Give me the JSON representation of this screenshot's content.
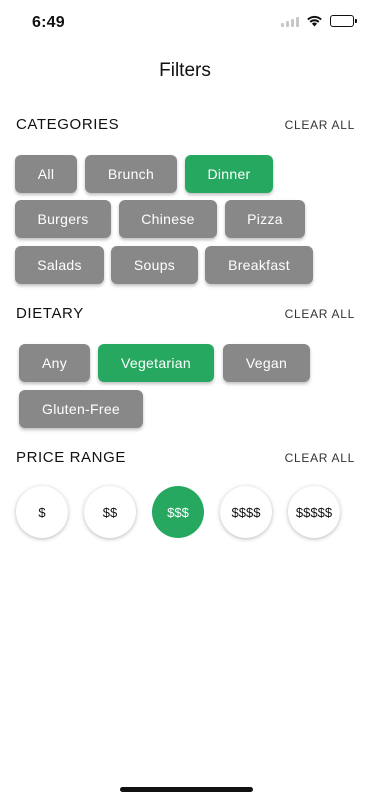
{
  "status_bar": {
    "time": "6:49"
  },
  "header": {
    "title": "Filters"
  },
  "categories": {
    "title": "CATEGORIES",
    "clear_label": "CLEAR ALL",
    "chips": [
      {
        "label": "All",
        "selected": false
      },
      {
        "label": "Brunch",
        "selected": false
      },
      {
        "label": "Dinner",
        "selected": true
      },
      {
        "label": "Burgers",
        "selected": false
      },
      {
        "label": "Chinese",
        "selected": false
      },
      {
        "label": "Pizza",
        "selected": false
      },
      {
        "label": "Salads",
        "selected": false
      },
      {
        "label": "Soups",
        "selected": false
      },
      {
        "label": "Breakfast",
        "selected": false
      }
    ]
  },
  "dietary": {
    "title": "DIETARY",
    "clear_label": "CLEAR ALL",
    "chips": [
      {
        "label": "Any",
        "selected": false
      },
      {
        "label": "Vegetarian",
        "selected": true
      },
      {
        "label": "Vegan",
        "selected": false
      },
      {
        "label": "Gluten-Free",
        "selected": false
      }
    ]
  },
  "price_range": {
    "title": "PRICE RANGE",
    "clear_label": "CLEAR ALL",
    "options": [
      {
        "label": "$",
        "selected": false
      },
      {
        "label": "$$",
        "selected": false
      },
      {
        "label": "$$$",
        "selected": true
      },
      {
        "label": "$$$$",
        "selected": false
      },
      {
        "label": "$$$$$",
        "selected": false
      }
    ]
  },
  "colors": {
    "accent": "#27a861",
    "chip_default": "#888888"
  }
}
